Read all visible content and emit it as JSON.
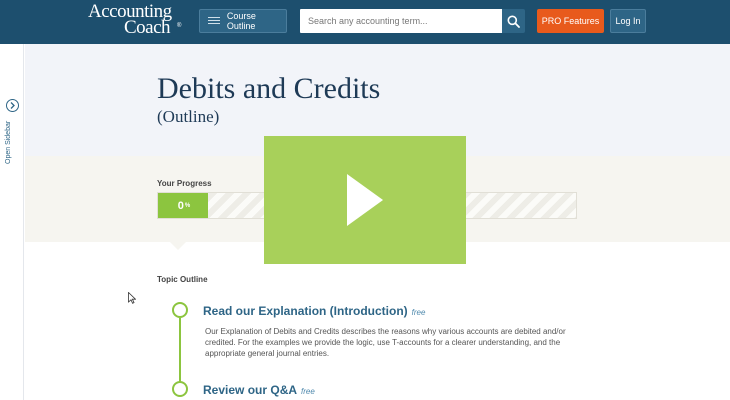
{
  "header": {
    "logo_line1": "Accounting",
    "logo_line2": "Coach",
    "logo_mark": "®",
    "course_outline_label": "Course Outline",
    "search_placeholder": "Search any accounting term...",
    "pro_label": "PRO Features",
    "login_label": "Log In"
  },
  "sidebar": {
    "toggle_label": "Open Sidebar"
  },
  "page": {
    "title": "Debits and Credits",
    "subtitle": "(Outline)"
  },
  "progress": {
    "label": "Your Progress",
    "value": "0",
    "unit": "%",
    "fraction": 0.12
  },
  "outline": {
    "heading": "Topic Outline",
    "items": [
      {
        "title": "Read our Explanation (Introduction)",
        "tag": "free",
        "description": "Our Explanation of Debits and Credits describes the reasons why various accounts are debited and/or credited. For the examples we provide the logic, use T-accounts for a clearer understanding, and the appropriate general journal entries."
      },
      {
        "title": "Review our Q&A",
        "tag": "free"
      }
    ]
  },
  "colors": {
    "header_bg": "#1d4f6e",
    "accent_green": "#8cc53f",
    "pro_orange": "#e85a1c",
    "link_blue": "#2e6586",
    "play_overlay": "#a8d05a"
  }
}
